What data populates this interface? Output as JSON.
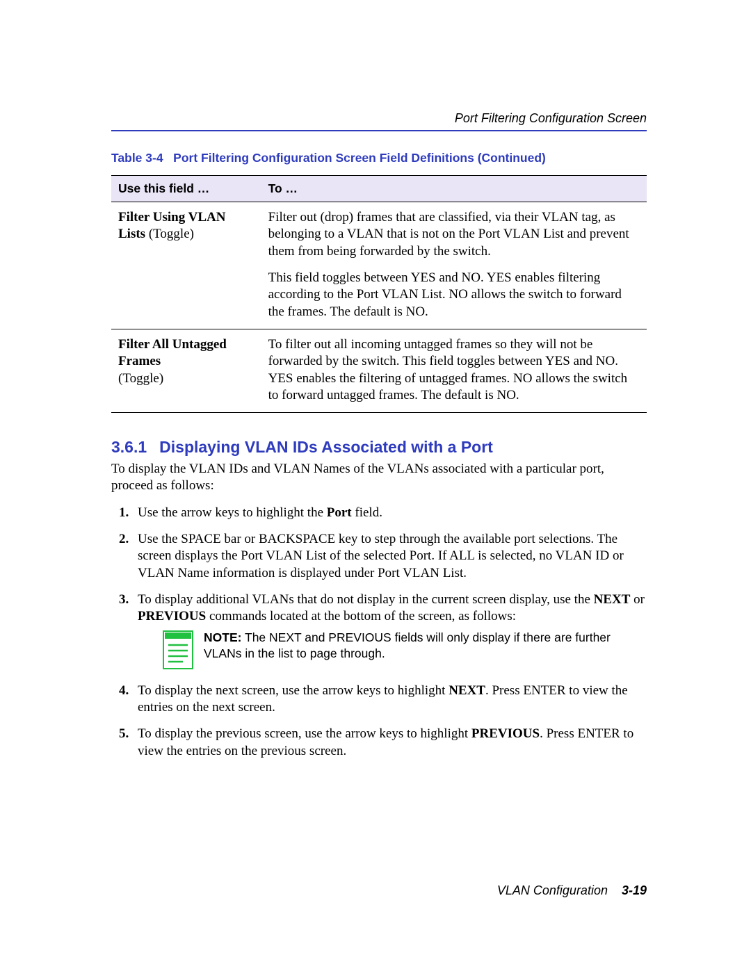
{
  "header": {
    "running_head": "Port Filtering Configuration Screen"
  },
  "table": {
    "caption_prefix": "Table 3-4",
    "caption_text": "Port Filtering Configuration Screen Field Definitions (Continued)",
    "col1": "Use this field …",
    "col2": "To …",
    "rows": [
      {
        "field_bold": "Filter Using VLAN Lists",
        "field_plain": " (Toggle)",
        "desc1": "Filter out (drop) frames that are classified, via their VLAN tag, as belonging to a VLAN that is not on the Port VLAN List and prevent them from being forwarded by the switch.",
        "desc2": "This field toggles between YES and NO. YES enables filtering according to the Port VLAN List. NO allows the switch to forward the frames. The default is NO."
      },
      {
        "field_bold": "Filter All Untagged Frames",
        "field_plain": " (Toggle)",
        "desc1": "To filter out all incoming untagged frames so they will not be forwarded by the switch. This field toggles between YES and NO. YES enables the filtering of untagged frames. NO allows the switch to forward untagged frames. The default is NO.",
        "desc2": ""
      }
    ]
  },
  "section": {
    "num": "3.6.1",
    "title": "Displaying VLAN IDs Associated with a Port",
    "intro": "To display the VLAN IDs and VLAN Names of the VLANs associated with a particular port, proceed as follows:",
    "steps": {
      "s1_a": "Use the arrow keys to highlight the ",
      "s1_b": "Port",
      "s1_c": " field.",
      "s2": "Use the SPACE bar or BACKSPACE key to step through the available port selections. The screen displays the Port VLAN List of the selected Port. If ALL is selected, no VLAN ID or VLAN Name information is displayed under Port VLAN List.",
      "s3_a": "To display additional VLANs that do not display in the current screen display, use the ",
      "s3_b": "NEXT",
      "s3_c": " or ",
      "s3_d": "PREVIOUS",
      "s3_e": " commands located at the bottom of the screen, as follows:",
      "s4_a": "To display the next screen, use the arrow keys to highlight ",
      "s4_b": "NEXT",
      "s4_c": ". Press ENTER to view the entries on the next screen.",
      "s5_a": "To display the previous screen, use the arrow keys to highlight ",
      "s5_b": "PREVIOUS",
      "s5_c": ". Press ENTER to view the entries on the previous screen."
    },
    "note_label": "NOTE:",
    "note_text": " The NEXT and PREVIOUS fields will only display if there are further VLANs in the list to page through."
  },
  "footer": {
    "doc": "VLAN Configuration",
    "page": "3-19"
  }
}
